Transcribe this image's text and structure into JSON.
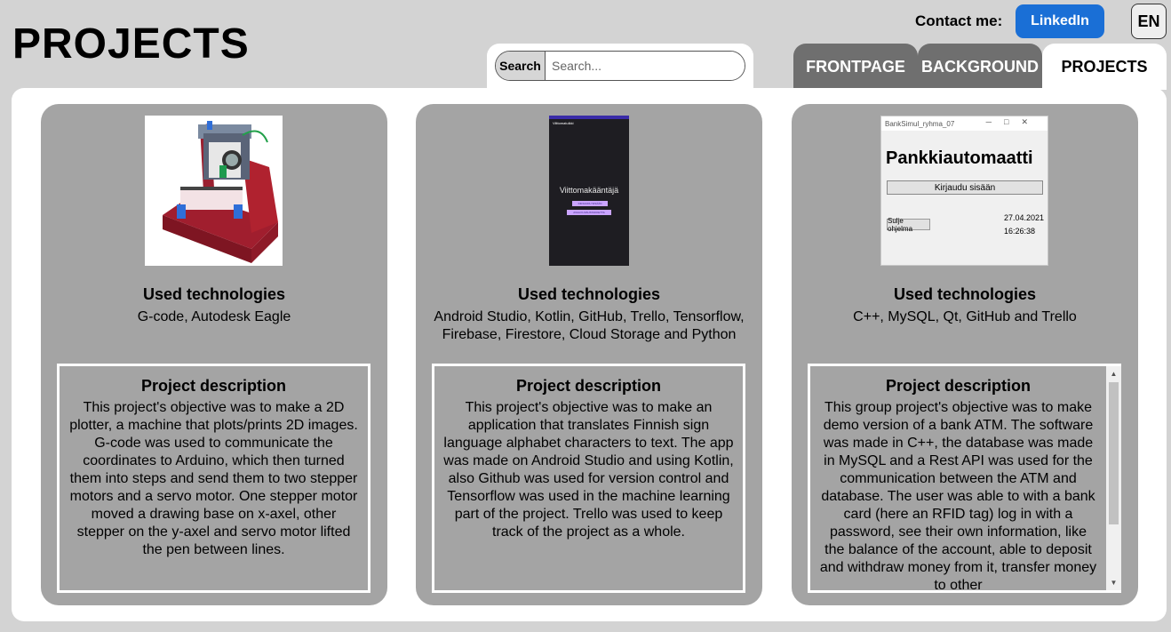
{
  "header": {
    "page_title": "PROJECTS",
    "contact_label": "Contact me:",
    "linkedin_label": "LinkedIn",
    "language": "EN"
  },
  "search": {
    "label": "Search",
    "placeholder": "Search...",
    "value": ""
  },
  "nav": {
    "tabs": [
      {
        "label": "FRONTPAGE",
        "active": false
      },
      {
        "label": "BACKGROUND",
        "active": false
      },
      {
        "label": "PROJECTS",
        "active": true
      }
    ]
  },
  "colors": {
    "background": "#d3d3d3",
    "card": "#a4a4a4",
    "inactive_tab": "#6f6f6f",
    "linkedin": "#1a6fd6"
  },
  "projects": [
    {
      "image": "plotter-photo",
      "tech_title": "Used technologies",
      "tech_text": "G-code, Autodesk Eagle",
      "desc_title": "Project description",
      "desc_text": "This project's objective was to make a 2D plotter, a machine that plots/prints 2D images. G-code was used to communicate the coordinates to Arduino, which then turned them into steps and send them to two stepper motors and a servo motor. One stepper motor moved a drawing base on x-axel, other stepper on the y-axel and servo motor lifted the pen between lines."
    },
    {
      "image": "android-app-screenshot",
      "image_texts": {
        "app_bar": "Viittomatulkki",
        "screen_title": "Viittomakääntäjä",
        "button1": "KIRJAUDU SISÄÄN",
        "button2": "AVAA KUVAUSTAKKETTA"
      },
      "tech_title": "Used technologies",
      "tech_text": "Android Studio, Kotlin, GitHub, Trello, Tensorflow, Firebase, Firestore, Cloud Storage and Python",
      "desc_title": "Project description",
      "desc_text": "This project's objective was to make an application that translates Finnish sign language alphabet characters to text. The app was made on Android Studio and using Kotlin, also Github was used for version control and Tensorflow was used in the machine learning part of the project. Trello was used to keep track of the project as a whole."
    },
    {
      "image": "bank-app-screenshot",
      "image_texts": {
        "window_title": "BankSimul_ryhma_07",
        "heading": "Pankkiautomaatti",
        "login_button": "Kirjaudu sisään",
        "close_button": "Sulje ohjelma",
        "date": "27.04.2021",
        "time": "16:26:38"
      },
      "tech_title": "Used technologies",
      "tech_text": "C++, MySQL, Qt, GitHub and Trello",
      "desc_title": "Project description",
      "desc_text": "This group project's objective was to make demo version of a bank ATM. The software was made in C++, the database was made in MySQL and a Rest API was used for the communication between the ATM and database. The user was able to with a bank card (here an RFID tag) log in with a password, see their own information, like the balance of the account, able to deposit and withdraw money from it, transfer money to other"
    }
  ]
}
